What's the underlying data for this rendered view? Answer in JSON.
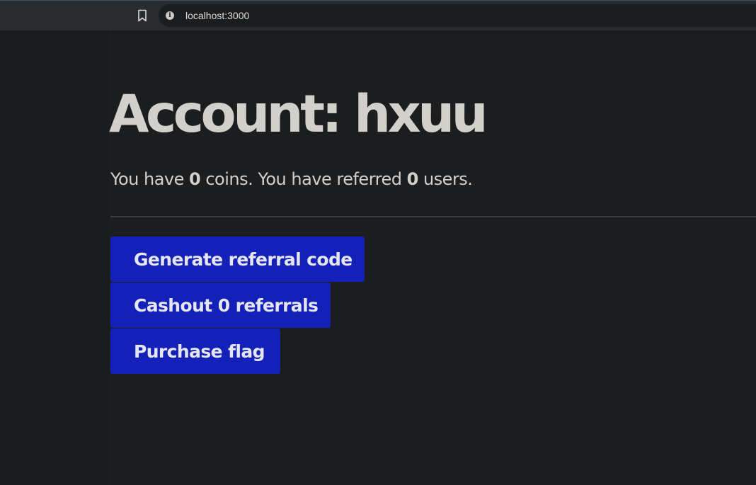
{
  "browser": {
    "url": "localhost:3000",
    "bookmark_icon": "bookmark-icon",
    "info_icon": "info-icon",
    "info_glyph": "i"
  },
  "page": {
    "title": "Account: hxuu",
    "stats": {
      "prefix": "You have ",
      "coins": "0",
      "middle": " coins. You have referred ",
      "referred": "0",
      "suffix": " users."
    },
    "buttons": {
      "generate": "Generate referral code",
      "cashout": "Cashout 0 referrals",
      "purchase": "Purchase flag"
    }
  },
  "colors": {
    "background": "#1c1d1f",
    "text": "#d2d0cb",
    "button": "#1321b8",
    "button_text": "#e6e6f2"
  }
}
